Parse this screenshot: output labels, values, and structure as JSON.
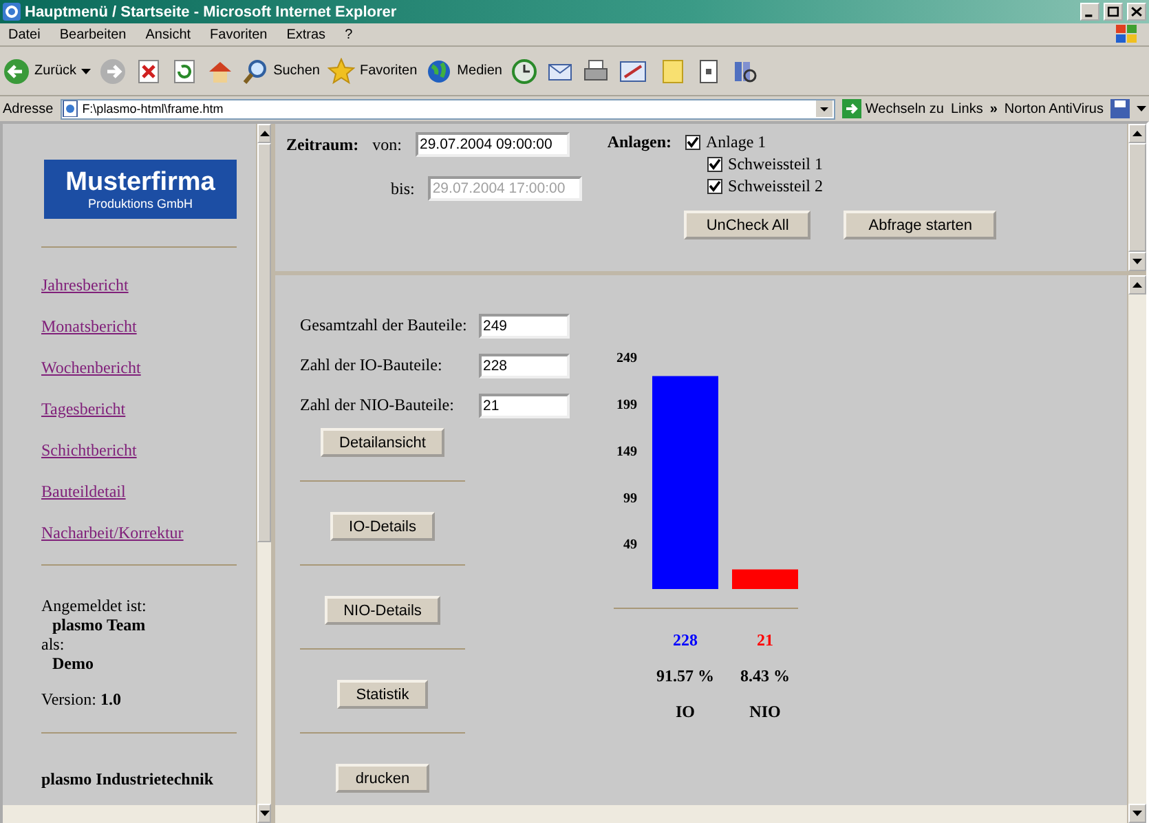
{
  "window": {
    "title": "Hauptmenü / Startseite - Microsoft Internet Explorer"
  },
  "menu": [
    "Datei",
    "Bearbeiten",
    "Ansicht",
    "Favoriten",
    "Extras",
    "?"
  ],
  "toolbar": {
    "back": "Zurück",
    "search": "Suchen",
    "favorites": "Favoriten",
    "media": "Medien"
  },
  "address_bar": {
    "label": "Adresse",
    "value": "F:\\plasmo-html\\frame.htm",
    "go": "Wechseln zu",
    "links": "Links",
    "chevron": "»",
    "norton": "Norton AntiVirus"
  },
  "sidebar": {
    "logo_title": "Musterfirma",
    "logo_subtitle": "Produktions GmbH",
    "links": [
      "Jahresbericht",
      "Monatsbericht",
      "Wochenbericht",
      "Tagesbericht",
      "Schichtbericht",
      "Bauteildetail",
      "Nacharbeit/Korrektur"
    ],
    "login_label": "Angemeldet ist:",
    "user": "plasmo Team",
    "role_label": "als:",
    "role": "Demo",
    "version_label": "Version:",
    "version": "1.0",
    "company": "plasmo Industrietechnik"
  },
  "filter": {
    "period_label": "Zeitraum:",
    "from_label": "von:",
    "from": {
      "value": "29.07.2004 09:00:00",
      "disabled": false
    },
    "to_label": "bis:",
    "to": {
      "value": "29.07.2004 17:00:00",
      "disabled": true
    },
    "plants_label": "Anlagen:",
    "plants": [
      {
        "label": "Anlage 1",
        "checked": true,
        "children": [
          {
            "label": "Schweissteil 1",
            "checked": true
          },
          {
            "label": "Schweissteil 2",
            "checked": true
          }
        ]
      }
    ],
    "buttons": [
      "UnCheck All",
      "Abfrage starten"
    ]
  },
  "counts": [
    {
      "label": "Gesamtzahl der Bauteile:",
      "value": "249"
    },
    {
      "label": "Zahl der IO-Bauteile:",
      "value": "228"
    },
    {
      "label": "Zahl der NIO-Bauteile:",
      "value": "21"
    }
  ],
  "detail_buttons": [
    "Detailansicht",
    "IO-Details",
    "NIO-Details",
    "Statistik",
    "drucken"
  ],
  "results": [
    {
      "count": "228",
      "percent": "91.57 %",
      "color": "#0000ff"
    },
    {
      "count": "21",
      "percent": "8.43 %",
      "color": "#ff0000"
    }
  ],
  "chart_data": {
    "type": "bar",
    "stacked": true,
    "series": [
      {
        "name": "IO",
        "color": "#0000ff",
        "values": [
          228,
          null
        ]
      },
      {
        "name": "NIO",
        "color": "#ff0000",
        "values": [
          null,
          21
        ]
      }
    ],
    "ylim": [
      0,
      249
    ],
    "yticks": [
      49,
      99,
      149,
      199,
      249
    ]
  }
}
